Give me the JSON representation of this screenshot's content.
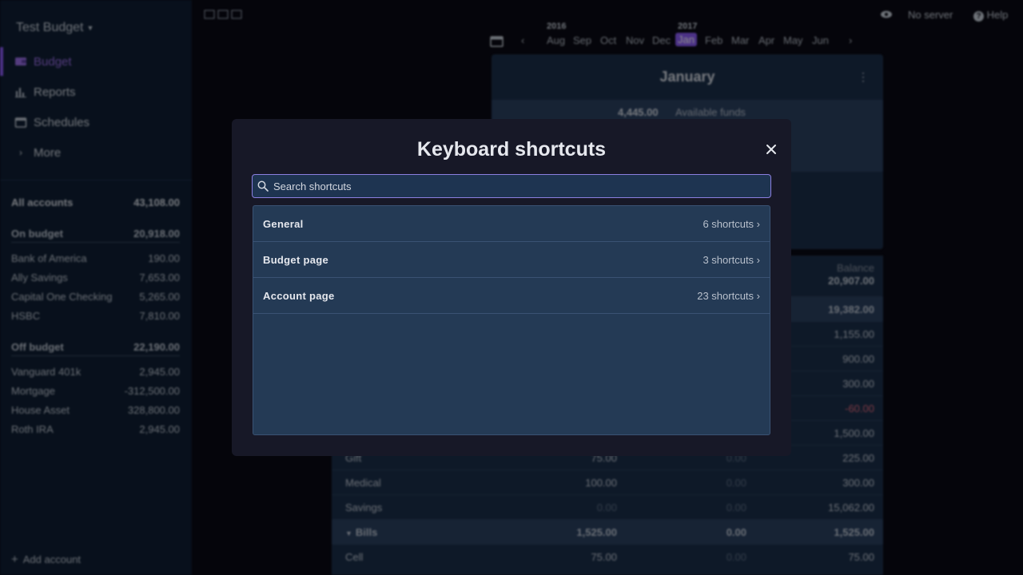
{
  "sidebar": {
    "budget_name": "Test Budget",
    "nav": [
      {
        "label": "Budget",
        "icon": "wallet-icon"
      },
      {
        "label": "Reports",
        "icon": "chart-icon"
      },
      {
        "label": "Schedules",
        "icon": "calendar-icon"
      },
      {
        "label": "More",
        "icon": "chevron-right-icon"
      }
    ],
    "all_accounts": {
      "label": "All accounts",
      "value": "43,108.00"
    },
    "on_budget": {
      "label": "On budget",
      "value": "20,918.00"
    },
    "on_budget_accounts": [
      {
        "name": "Bank of America",
        "value": "190.00"
      },
      {
        "name": "Ally Savings",
        "value": "7,653.00"
      },
      {
        "name": "Capital One Checking",
        "value": "5,265.00"
      },
      {
        "name": "HSBC",
        "value": "7,810.00"
      }
    ],
    "off_budget": {
      "label": "Off budget",
      "value": "22,190.00"
    },
    "off_budget_accounts": [
      {
        "name": "Vanguard 401k",
        "value": "2,945.00"
      },
      {
        "name": "Mortgage",
        "value": "-312,500.00"
      },
      {
        "name": "House Asset",
        "value": "328,800.00"
      },
      {
        "name": "Roth IRA",
        "value": "2,945.00"
      }
    ],
    "add_account": "Add account"
  },
  "topbar": {
    "server_label": "No server",
    "help_label": "Help"
  },
  "months": {
    "year_left": "2016",
    "year_right": "2017",
    "list": [
      "Aug",
      "Sep",
      "Oct",
      "Nov",
      "Dec",
      "Jan",
      "Feb",
      "Mar",
      "Apr",
      "May",
      "Jun"
    ],
    "selected": "Jan"
  },
  "budget_card": {
    "month": "January",
    "available_value": "4,445.00",
    "available_label": "Available funds"
  },
  "table": {
    "balance_header": "Balance",
    "balance_total": "20,907.00",
    "rows": [
      {
        "name": "",
        "budgeted": "",
        "spent": "",
        "balance": "19,382.00",
        "group": true
      },
      {
        "name": "",
        "budgeted": "",
        "spent": "",
        "balance": "1,155.00"
      },
      {
        "name": "",
        "budgeted": "",
        "spent": "",
        "balance": "900.00"
      },
      {
        "name": "",
        "budgeted": "",
        "spent": "",
        "balance": "300.00"
      },
      {
        "name": "",
        "budgeted": "",
        "spent": "",
        "balance": "-60.00",
        "negative": true
      },
      {
        "name": "",
        "budgeted": "",
        "spent": "",
        "balance": "1,500.00"
      },
      {
        "name": "Gift",
        "budgeted": "75.00",
        "spent": "0.00",
        "balance": "225.00"
      },
      {
        "name": "Medical",
        "budgeted": "100.00",
        "spent": "0.00",
        "balance": "300.00"
      },
      {
        "name": "Savings",
        "budgeted": "0.00",
        "spent": "0.00",
        "balance": "15,062.00"
      },
      {
        "name": "Bills",
        "budgeted": "1,525.00",
        "spent": "0.00",
        "balance": "1,525.00",
        "group": true
      },
      {
        "name": "Cell",
        "budgeted": "75.00",
        "spent": "0.00",
        "balance": "75.00"
      }
    ]
  },
  "modal": {
    "title": "Keyboard shortcuts",
    "search_placeholder": "Search shortcuts",
    "categories": [
      {
        "name": "General",
        "count": "6 shortcuts ›"
      },
      {
        "name": "Budget page",
        "count": "3 shortcuts ›"
      },
      {
        "name": "Account page",
        "count": "23 shortcuts ›"
      }
    ]
  },
  "colors": {
    "accent": "#8b5cf6",
    "negative": "#e0677a"
  }
}
